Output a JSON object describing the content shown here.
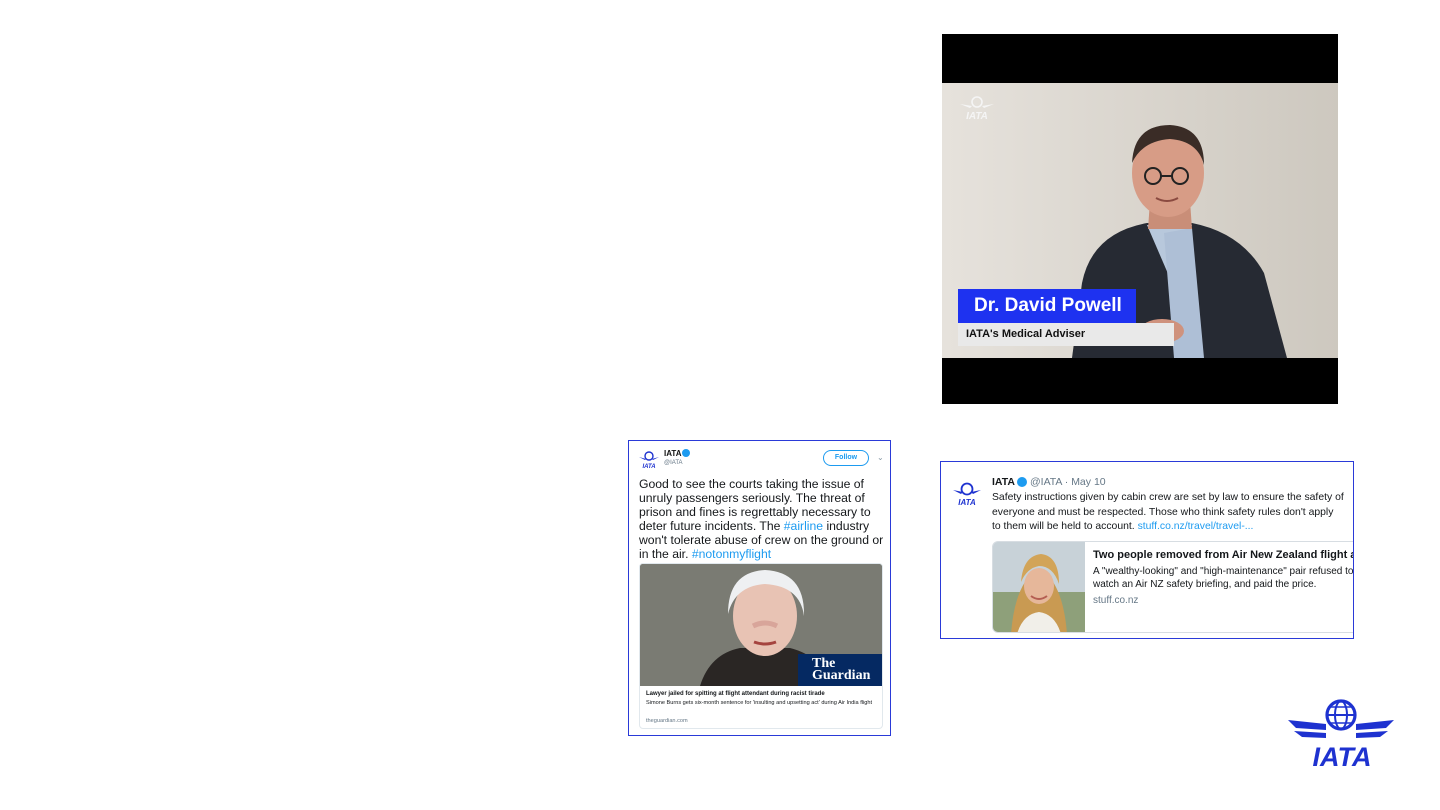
{
  "video": {
    "name": "Dr. David Powell",
    "role": "IATA's Medical Adviser",
    "watermark_text": "IATA"
  },
  "tweet_left": {
    "account": "IATA",
    "handle": "@IATA",
    "follow_label": "Follow",
    "text_prefix": "Good to see the courts taking the issue of unruly passengers seriously. The threat of prison and fines is regrettably necessary to deter future incidents. The ",
    "hashtag_1": "#airline",
    "text_middle": " industry won't tolerate abuse of crew on the ground or in the air.  ",
    "hashtag_2": "#notonmyflight",
    "card": {
      "brand_line1": "The",
      "brand_line2": "Guardian",
      "title": "Lawyer jailed for spitting at flight attendant during racist tirade",
      "description": "Simone Burns gets six-month sentence for 'insulting and upsetting act' during Air India flight",
      "domain": "theguardian.com"
    }
  },
  "tweet_right": {
    "account": "IATA",
    "meta": "@IATA · May 10",
    "text": "Safety instructions given by cabin crew are set by law to ensure the safety of everyone and must be respected. Those who think safety rules don't apply to them will be held to account. ",
    "link": "stuff.co.nz/travel/travel-...",
    "card": {
      "title": "Two people removed from Air New Zealand flight af...",
      "description": "A \"wealthy-looking\" and \"high-maintenance\" pair refused to watch an Air NZ safety briefing, and paid the price.",
      "domain": "stuff.co.nz"
    }
  },
  "corner_logo_text": "IATA",
  "colors": {
    "iata_blue": "#1e32d0",
    "lower_third_blue": "#1e32f0",
    "twitter_blue": "#1d9bf0",
    "guardian_navy": "#052962"
  }
}
